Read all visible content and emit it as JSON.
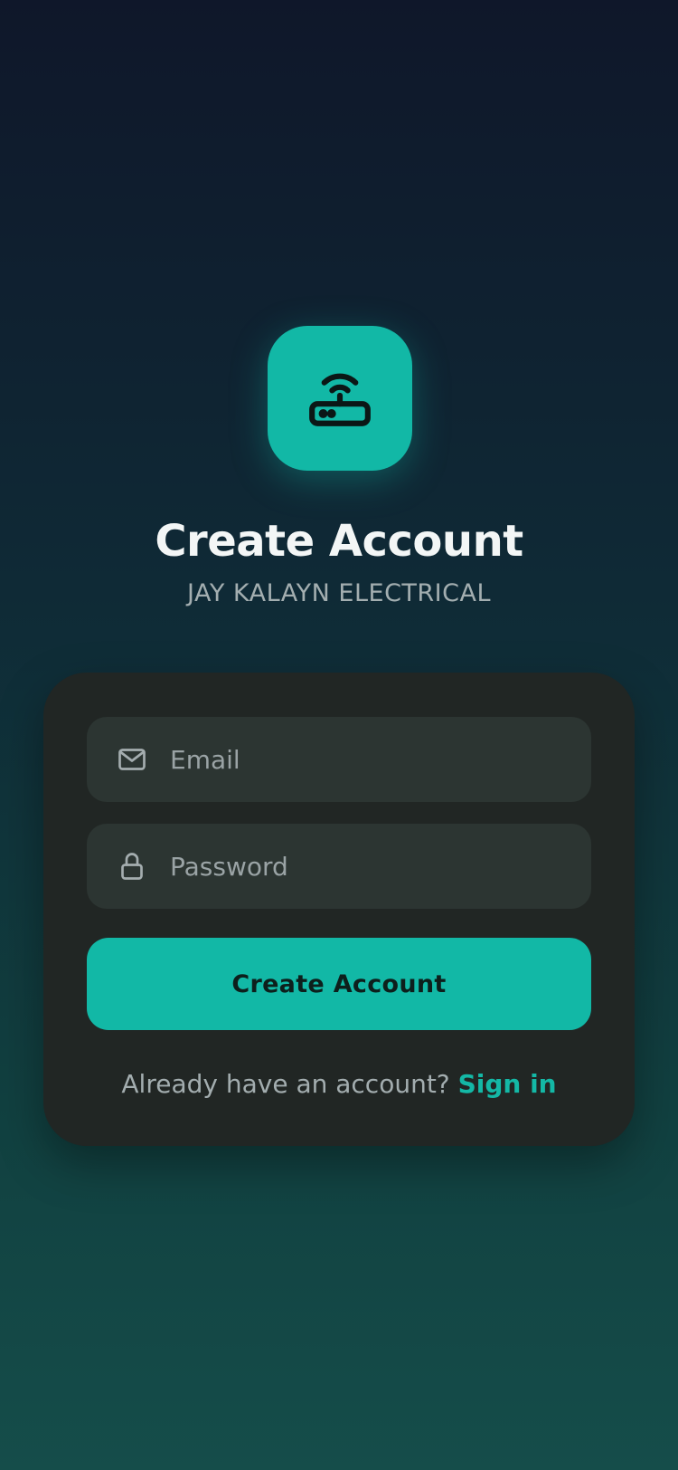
{
  "header": {
    "title": "Create Account",
    "subtitle": "JAY KALAYN ELECTRICAL",
    "app_icon": "router-wifi-icon"
  },
  "form": {
    "email": {
      "icon": "mail-icon",
      "placeholder": "Email",
      "value": ""
    },
    "password": {
      "icon": "lock-icon",
      "placeholder": "Password",
      "value": ""
    },
    "submit_label": "Create Account",
    "footer_text": "Already have an account?",
    "footer_link": "Sign in"
  },
  "colors": {
    "accent": "#12b8a6",
    "card": "#212624",
    "field": "#2c3532",
    "background_top": "#0f172a",
    "background_bottom": "#154d4a"
  }
}
